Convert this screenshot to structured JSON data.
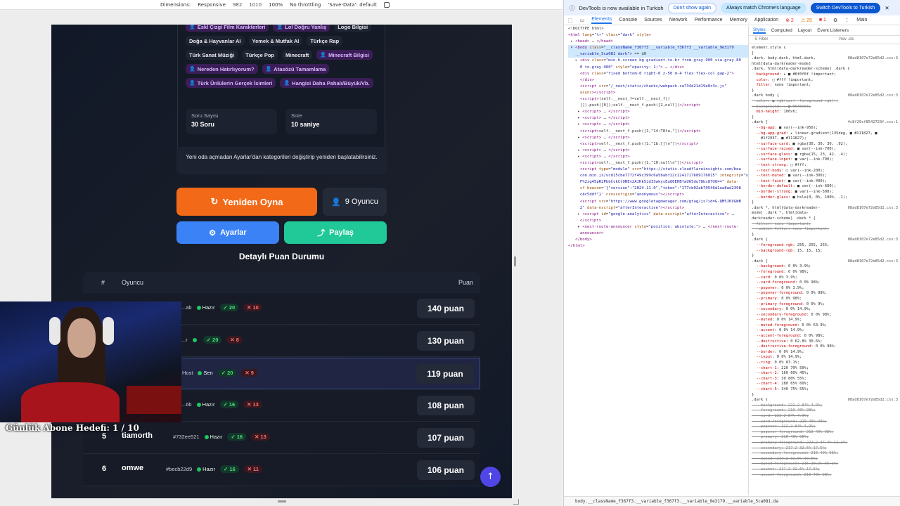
{
  "device_toolbar": {
    "dimensions_label": "Dimensions:",
    "device": "Responsive",
    "width": "982",
    "height": "1010",
    "zoom": "100%",
    "throttle": "No throttling",
    "save_data": "'Save-Data': default"
  },
  "categories": [
    {
      "label": "Eskİ Çizgi Film Karakterleri",
      "custom": true
    },
    {
      "label": "Lol Doğru Yanlış",
      "custom": true
    },
    {
      "label": "Logo Bilgisi",
      "custom": false
    },
    {
      "label": "Doğa & Hayvanlar AI",
      "custom": false
    },
    {
      "label": "Yemek & Mutfak AI",
      "custom": false
    },
    {
      "label": "Türkçe Rap",
      "custom": false
    },
    {
      "label": "Türk Sanat Müziği",
      "custom": false
    },
    {
      "label": "Türkçe Pop",
      "custom": false
    },
    {
      "label": "Minecraft",
      "custom": false
    },
    {
      "label": "Minecraft Bilgisi",
      "custom": true
    },
    {
      "label": "Nereden Hatırlıyorum?",
      "custom": true
    },
    {
      "label": "Atasözü Tamamlama",
      "custom": true
    },
    {
      "label": "Türk Ünlülerin Gerçek İsimleri",
      "custom": true
    },
    {
      "label": "Hangisi Daha Pahalı/Büyük/Vb.",
      "custom": true
    }
  ],
  "stats": {
    "questions_label": "Soru Sayısı",
    "questions_value": "30 Soru",
    "time_label": "Süre",
    "time_value": "10 saniye"
  },
  "notice": "Yeni oda açmadan Ayarlar'dan kategorileri değiştirip yeniden başlatabilirsiniz.",
  "buttons": {
    "replay": "Yeniden Oyna",
    "players": "9 Oyuncu",
    "settings": "Ayarlar",
    "share": "Paylaş"
  },
  "scoreboard": {
    "title": "Detaylı Puan Durumu",
    "col_rank": "#",
    "col_player": "Oyuncu",
    "col_score": "Puan",
    "rows": [
      {
        "rank": "",
        "name": "",
        "tag": "...ab",
        "status": "Hazır",
        "correct": "20",
        "wrong": "10",
        "score": "140 puan"
      },
      {
        "rank": "",
        "name": "",
        "tag": "...r",
        "status": "",
        "correct": "20",
        "wrong": "8",
        "score": "130 puan"
      },
      {
        "rank": "",
        "name": "",
        "tag": "Host",
        "status": "Sen",
        "correct": "20",
        "wrong": "9",
        "score": "119 puan"
      },
      {
        "rank": "",
        "name": "",
        "tag": "...6b",
        "status": "Hazır",
        "correct": "16",
        "wrong": "13",
        "score": "108 puan"
      },
      {
        "rank": "5",
        "name": "tiamorth",
        "tag": "#732ee521",
        "status": "Hazır",
        "correct": "16",
        "wrong": "13",
        "score": "107 puan"
      },
      {
        "rank": "6",
        "name": "omwe",
        "tag": "#becb22d9",
        "status": "Hazır",
        "correct": "16",
        "wrong": "11",
        "score": "106 puan"
      }
    ]
  },
  "stream_overlay": {
    "sub_goal": "Günlük Abone Hedefi: 1 / 10"
  },
  "devtools": {
    "banner_text": "DevTools is now available in Turkish",
    "btn_dont_show": "Don't show again",
    "btn_match": "Always match Chrome's language",
    "btn_switch": "Switch DevTools to Turkish",
    "tabs": [
      "Elements",
      "Console",
      "Sources",
      "Network",
      "Performance",
      "Memory",
      "Application"
    ],
    "errors": "2",
    "warnings": "25",
    "issues": "1",
    "context": "Main",
    "style_tabs": [
      "Styles",
      "Computed",
      "Layout",
      "Event Listeners"
    ],
    "filter_placeholder": "Filter",
    "filter_hints": ":hov .cls",
    "breadcrumb": "body.__className_f367f3.__variable_f367f3.__variable_9e3179.__variable_5ca081.da"
  }
}
